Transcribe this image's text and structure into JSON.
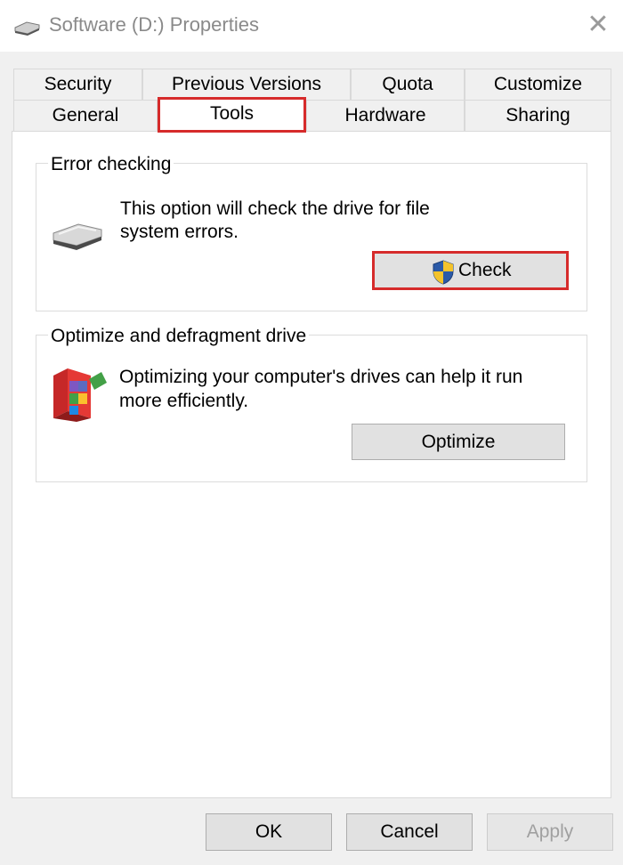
{
  "window": {
    "title": "Software (D:) Properties",
    "close_glyph": "✕"
  },
  "tabs": {
    "row1": [
      "Security",
      "Previous Versions",
      "Quota",
      "Customize"
    ],
    "row2": [
      "General",
      "Tools",
      "Hardware",
      "Sharing"
    ],
    "active": "Tools"
  },
  "error_checking": {
    "group_label": "Error checking",
    "description_line1": "This option will check the drive for file",
    "description_line2": "system errors.",
    "button_label": "Check",
    "icon": "drive-icon",
    "button_icon": "uac-shield-icon"
  },
  "optimize": {
    "group_label": "Optimize and defragment drive",
    "description_line1": "Optimizing your computer's drives can help it run",
    "description_line2": "more efficiently.",
    "button_label": "Optimize",
    "icon": "defrag-icon"
  },
  "footer": {
    "ok_label": "OK",
    "cancel_label": "Cancel",
    "apply_label": "Apply"
  },
  "colors": {
    "highlight": "#d62b2b",
    "panel": "#ffffff",
    "background": "#f0f0f0"
  }
}
